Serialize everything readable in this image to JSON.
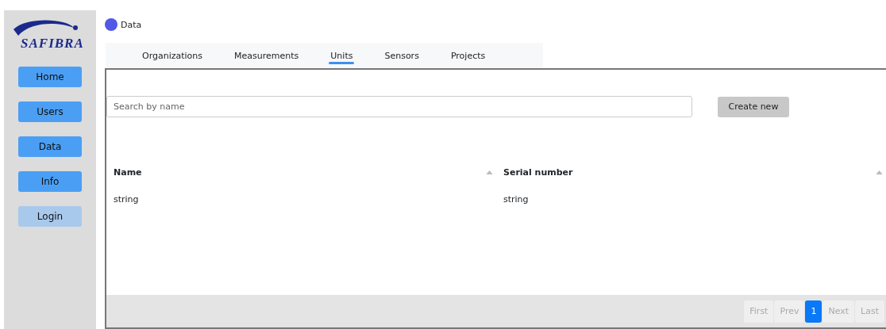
{
  "sidebar": {
    "logo": "SAFIBRA",
    "items": [
      {
        "label": "Home",
        "disabled": false
      },
      {
        "label": "Users",
        "disabled": false
      },
      {
        "label": "Data",
        "disabled": false
      },
      {
        "label": "Info",
        "disabled": false
      },
      {
        "label": "Login",
        "disabled": true
      }
    ]
  },
  "breadcrumb": {
    "label": "Data",
    "color": "#5159e6"
  },
  "tabs": [
    {
      "label": "Organizations",
      "selected": false
    },
    {
      "label": "Measurements",
      "selected": false
    },
    {
      "label": "Units",
      "selected": true
    },
    {
      "label": "Sensors",
      "selected": false
    },
    {
      "label": "Projects",
      "selected": false
    }
  ],
  "search": {
    "placeholder": "Search by name"
  },
  "create_button": "Create new",
  "table": {
    "columns": [
      "Name",
      "Serial number"
    ],
    "rows": [
      [
        "string",
        "string"
      ]
    ]
  },
  "pagination": [
    {
      "label": "First",
      "selected": false
    },
    {
      "label": "Prev",
      "selected": false
    },
    {
      "label": "1",
      "selected": true
    },
    {
      "label": "Next",
      "selected": false
    },
    {
      "label": "Last",
      "selected": false
    }
  ]
}
